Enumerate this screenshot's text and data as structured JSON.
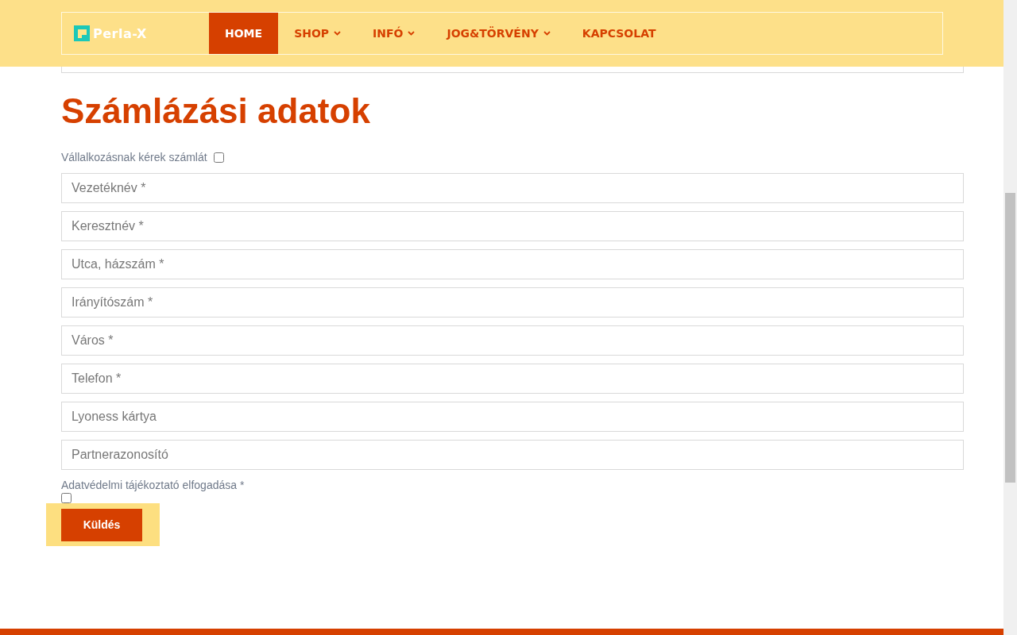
{
  "header": {
    "logo": "Perla-X",
    "nav": [
      {
        "label": "HOME",
        "selected": true,
        "dropdown": false
      },
      {
        "label": "SHOP",
        "selected": false,
        "dropdown": true
      },
      {
        "label": "INFÓ",
        "selected": false,
        "dropdown": true
      },
      {
        "label": "JOG&TÖRVÉNY",
        "selected": false,
        "dropdown": true
      },
      {
        "label": "KAPCSOLAT",
        "selected": false,
        "dropdown": false
      }
    ]
  },
  "billing": {
    "heading": "Számlázási adatok",
    "company_invoice": {
      "label": "Vállalkozásnak kérek számlát",
      "checked": false
    },
    "fields": [
      {
        "placeholder": "Vezetéknév *"
      },
      {
        "placeholder": "Keresztnév *"
      },
      {
        "placeholder": "Utca, házszám *"
      },
      {
        "placeholder": "Irányítószám *"
      },
      {
        "placeholder": "Város *"
      },
      {
        "placeholder": "Telefon *"
      },
      {
        "placeholder": "Lyoness kártya"
      },
      {
        "placeholder": "Partnerazonosító"
      }
    ],
    "privacy": {
      "label": "Adatvédelmi tájékoztató elfogadása *",
      "checked": false
    },
    "submit": "Küldés"
  }
}
